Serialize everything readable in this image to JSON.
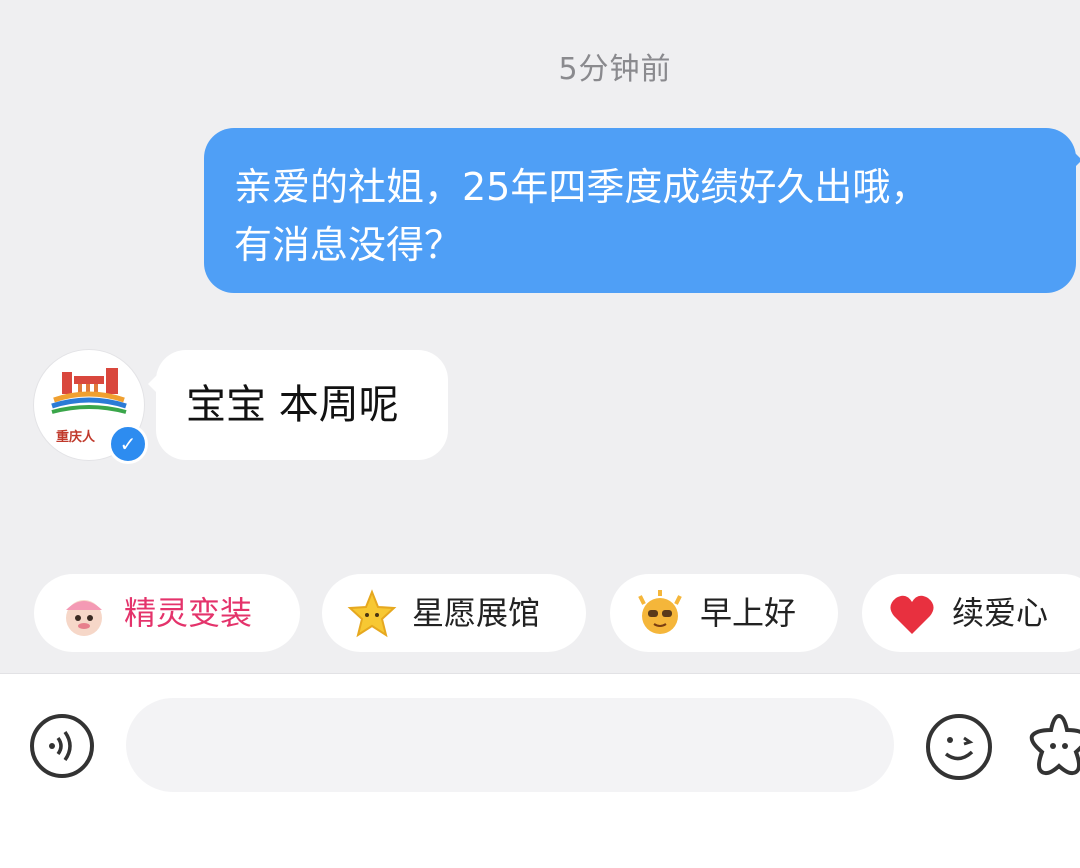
{
  "chat": {
    "timestamp": "5分钟前",
    "outgoing": {
      "line1": "亲爱的社姐，25年四季度成绩好久出哦，",
      "line2": "有消息没得？"
    },
    "incoming": {
      "text": "宝宝 本周呢",
      "avatar_logo_text": "重庆人",
      "verified_icon": "verified-badge-icon"
    }
  },
  "quick_actions": [
    {
      "label": "精灵变装",
      "icon": "elf-avatar-icon",
      "color": "#e4336b"
    },
    {
      "label": "星愿展馆",
      "icon": "star-icon",
      "color": "#222222"
    },
    {
      "label": "早上好",
      "icon": "sun-face-icon",
      "color": "#222222"
    },
    {
      "label": "续爱心",
      "icon": "heart-icon",
      "color": "#222222"
    }
  ],
  "input_bar": {
    "placeholder": "",
    "voice_icon": "voice-icon",
    "emoji_icon": "emoji-icon",
    "sticker_icon": "star-sticker-icon"
  },
  "colors": {
    "outgoing_bubble": "#4f9ff6",
    "background": "#efeff1",
    "verified": "#2d8cf0"
  }
}
